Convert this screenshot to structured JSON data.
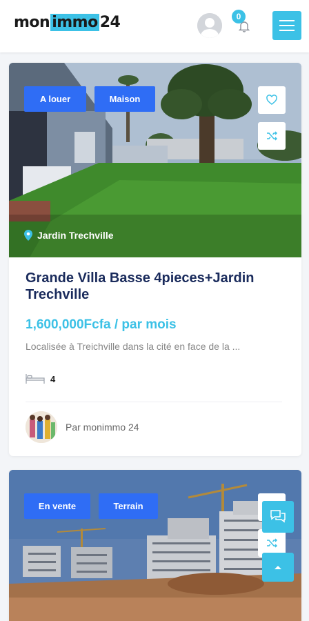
{
  "header": {
    "logo": {
      "part1": "mon",
      "part2": "immo",
      "part3": "24"
    },
    "notifications_count": "0",
    "icons": {
      "avatar": "user-avatar-icon",
      "bell": "bell-icon",
      "menu": "hamburger-menu-icon"
    },
    "accent_color": "#3cc1e6"
  },
  "listings": [
    {
      "tags": [
        "A louer",
        "Maison"
      ],
      "location": "Jardin Trechville",
      "title": "Grande Villa Basse 4pieces+Jardin Trechville",
      "price": "1,600,000Fcfa / par mois",
      "description": "Localisée à Treichville dans la cité en face de la ...",
      "bedrooms": "4",
      "author": "Par monimmo 24"
    },
    {
      "tags": [
        "En vente",
        "Terrain"
      ]
    }
  ],
  "colors": {
    "tag": "#2f6df5",
    "title": "#1a2b5c",
    "price": "#3cc1e6"
  }
}
